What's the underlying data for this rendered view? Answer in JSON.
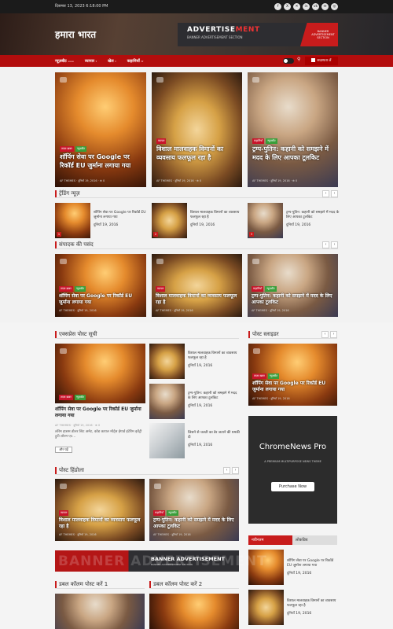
{
  "topbar": {
    "date": "दिसम्बर 13, 2023 6:18:00 PM",
    "social": [
      "f",
      "X",
      "✕",
      "in",
      "vk",
      "✉",
      "◎"
    ]
  },
  "header": {
    "site_title": "हमारा भारत"
  },
  "ad": {
    "title_main": "ADVERTISE",
    "title_accent": "MENT",
    "subtitle": "BANNER ADVERTISEMENT SECTION",
    "badge": "BANNER ADVERTISEMENT SECTION"
  },
  "nav": {
    "items": [
      {
        "label": "न्यूज़बीट",
        "badge": "≡≡≡"
      },
      {
        "label": "व्यापार",
        "badge": "▾"
      },
      {
        "label": "खेल",
        "badge": "▾"
      },
      {
        "label": "कहानियाँ",
        "badge": "▾▾"
      }
    ],
    "subscribe": "सदस्यता लें",
    "search": "⚲"
  },
  "meta_author": "AF THEMES",
  "meta_date": "दुनियाँ 19, 2016",
  "meta_views": "⊕ 0",
  "hero": [
    {
      "tags": [
        "ताज़ा ख़बर",
        "न्यूज़बीट"
      ],
      "title": "शॉपिंग सेवा पर Google पर रिकॉर्ड EU जुर्माना लगाया गया"
    },
    {
      "tags": [
        "व्यापार"
      ],
      "title": "विशाल मालवाहक विमानों का व्यवसाय फलफूल रहा है"
    },
    {
      "tags": [
        "कहानियाँ",
        "न्यूज़बीट"
      ],
      "title": "ट्रम्प-पुतिन: कहानी को समझने में मदद के लिए आपका टूलकिट"
    }
  ],
  "trending": {
    "title": "ट्रेंडिंग न्यूज़",
    "items": [
      {
        "num": "1",
        "title": "शॉपिंग सेवा पर Google पर रिकॉर्ड EU जुर्माना लगाया गया"
      },
      {
        "num": "2",
        "title": "विशाल मालवाहक विमानों का व्यवसाय फलफूल रहा है"
      },
      {
        "num": "3",
        "title": "ट्रम्प-पुतिन: कहानी को समझने में मदद के लिए आपका टूलकिट"
      }
    ]
  },
  "editor": {
    "title": "संपादक की पसंद",
    "items": [
      {
        "tags": [
          "ताज़ा ख़बर",
          "न्यूज़बीट"
        ],
        "title": "शॉपिंग सेवा पर Google पर रिकॉर्ड EU जुर्माना लगाया गया"
      },
      {
        "tags": [
          "व्यापार"
        ],
        "title": "विशाल मालवाहक विमानों का व्यवसाय फलफूल रहा है"
      },
      {
        "tags": [
          "कहानियाँ",
          "न्यूज़बीट"
        ],
        "title": "ट्रम्प-पुतिन: कहानी को समझने में मदद के लिए आपका टूलकिट"
      }
    ]
  },
  "express": {
    "title": "एक्सप्रेस पोस्ट सूची",
    "main_tags": [
      "ताज़ा ख़बर",
      "न्यूज़बीट"
    ],
    "main_title": "शॉपिंग सेवा पर Google पर रिकॉर्ड EU जुर्माना लगाया गया",
    "excerpt": "लॉरेम इप्सम डोलर सिट अमेट, कोड कायल मॉर्ट्स ईगार्ड इंटेरिम इवेंट्री ट्रुटी लोरम एट...",
    "more": "और पढ़ें",
    "list": [
      {
        "title": "विशाल मालवाहक विमानों का व्यवसाय फलफूल रहा है"
      },
      {
        "title": "ट्रम्प-पुतिन: कहानी को समझने में मदद के लिए आपका टूलकिट"
      },
      {
        "title": "जिसने से चलती का डेर जताने की धमकी दी"
      }
    ]
  },
  "slider": {
    "title": "पोस्ट स्लाइडर",
    "tags": [
      "ताज़ा ख़बर",
      "न्यूज़बीट"
    ],
    "item_title": "शॉपिंग सेवा पर Google पर रिकॉर्ड EU जुर्माना लगाया गया"
  },
  "chrome_ad": {
    "title": "ChromeNews Pro",
    "sub": "A PREMIUM MULTIPURPOSE NEWS THEME",
    "button": "Purchase Now"
  },
  "video": {
    "title": "पोस्ट हिंडोला",
    "items": [
      {
        "tags": [
          "व्यापार"
        ],
        "title": "विशाल मालवाहक विमानों का व्यवसाय फलफूल रहा है"
      },
      {
        "tags": [
          "कहानियाँ",
          "न्यूज़बीट"
        ],
        "title": "ट्रम्प-पुतिन: कहानी को समझने में मदद के लिए आपका टूलकिट"
      }
    ]
  },
  "tabs": {
    "latest": "नवीनतम",
    "popular": "लोकप्रिय",
    "items": [
      {
        "title": "शॉपिंग सेवा पर Google पर रिकॉर्ड EU जुर्माना लगाया गया"
      },
      {
        "title": "विशाल मालवाहक विमानों का व्यवसाय फलफूल रहा है"
      }
    ]
  },
  "banner2": {
    "big": "BANNER ADVERTISEMENT",
    "title": "BANNER ADVERTISEMENT",
    "sub": "BANNER ADVERTISEMENT SECTION"
  },
  "double": {
    "col1": "डबल कॉलम पोस्ट करें 1",
    "col2": "डबल कॉलम पोस्ट करें 2"
  },
  "colors": {
    "accent": "#b30d0d",
    "dark": "#1b1b1b"
  }
}
